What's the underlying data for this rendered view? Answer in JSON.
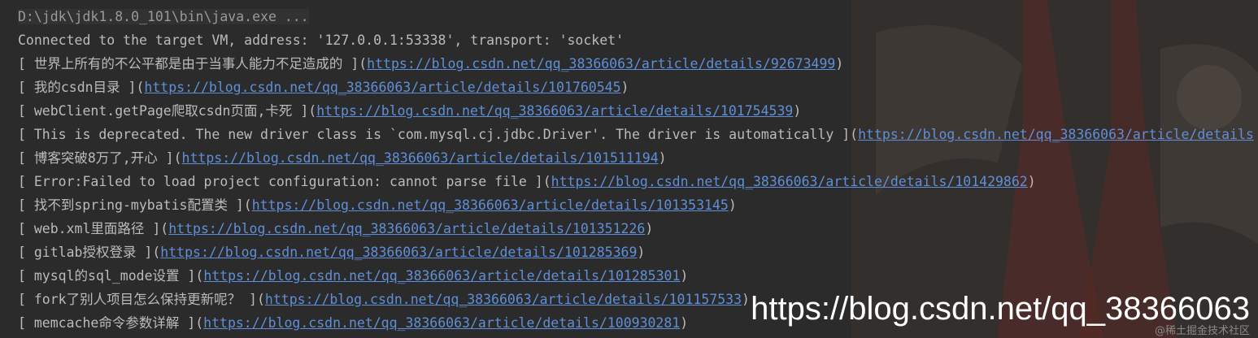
{
  "console": {
    "command": "D:\\jdk\\jdk1.8.0_101\\bin\\java.exe ...",
    "connected": "Connected to the target VM, address: '127.0.0.1:53338', transport: 'socket'",
    "entries": [
      {
        "prefix": "[ 世界上所有的不公平都是由于当事人能力不足造成的 ](",
        "url": "https://blog.csdn.net/qq_38366063/article/details/92673499",
        "suffix": ")"
      },
      {
        "prefix": "[ 我的csdn目录 ](",
        "url": "https://blog.csdn.net/qq_38366063/article/details/101760545",
        "suffix": ")"
      },
      {
        "prefix": "[ webClient.getPage爬取csdn页面,卡死 ](",
        "url": "https://blog.csdn.net/qq_38366063/article/details/101754539",
        "suffix": ")"
      },
      {
        "prefix": "[ This is deprecated. The new driver class is `com.mysql.cj.jdbc.Driver'. The driver is automatically ](",
        "url": "https://blog.csdn.net/qq_38366063/article/details",
        "suffix": ""
      },
      {
        "prefix": "[ 博客突破8万了,开心 ](",
        "url": "https://blog.csdn.net/qq_38366063/article/details/101511194",
        "suffix": ")"
      },
      {
        "prefix": "[ Error:Failed to load project configuration: cannot parse file ](",
        "url": "https://blog.csdn.net/qq_38366063/article/details/101429862",
        "suffix": ")"
      },
      {
        "prefix": "[ 找不到spring-mybatis配置类 ](",
        "url": "https://blog.csdn.net/qq_38366063/article/details/101353145",
        "suffix": ")"
      },
      {
        "prefix": "[ web.xml里面路径 ](",
        "url": "https://blog.csdn.net/qq_38366063/article/details/101351226",
        "suffix": ")"
      },
      {
        "prefix": "[ gitlab授权登录 ](",
        "url": "https://blog.csdn.net/qq_38366063/article/details/101285369",
        "suffix": ")"
      },
      {
        "prefix": "[ mysql的sql_mode设置 ](",
        "url": "https://blog.csdn.net/qq_38366063/article/details/101285301",
        "suffix": ")"
      },
      {
        "prefix": "[ fork了别人项目怎么保持更新呢？ ](",
        "url": "https://blog.csdn.net/qq_38366063/article/details/101157533",
        "suffix": ")"
      },
      {
        "prefix": "[ memcache命令参数详解 ](",
        "url": "https://blog.csdn.net/qq_38366063/article/details/100930281",
        "suffix": ")"
      }
    ]
  },
  "watermark": {
    "main": "https://blog.csdn.net/qq_38366063",
    "small": "@稀土掘金技术社区"
  },
  "colors": {
    "background": "#2b2b2b",
    "text": "#bbbbbb",
    "link": "#5f8fd8",
    "watermark": "#ffffff"
  }
}
